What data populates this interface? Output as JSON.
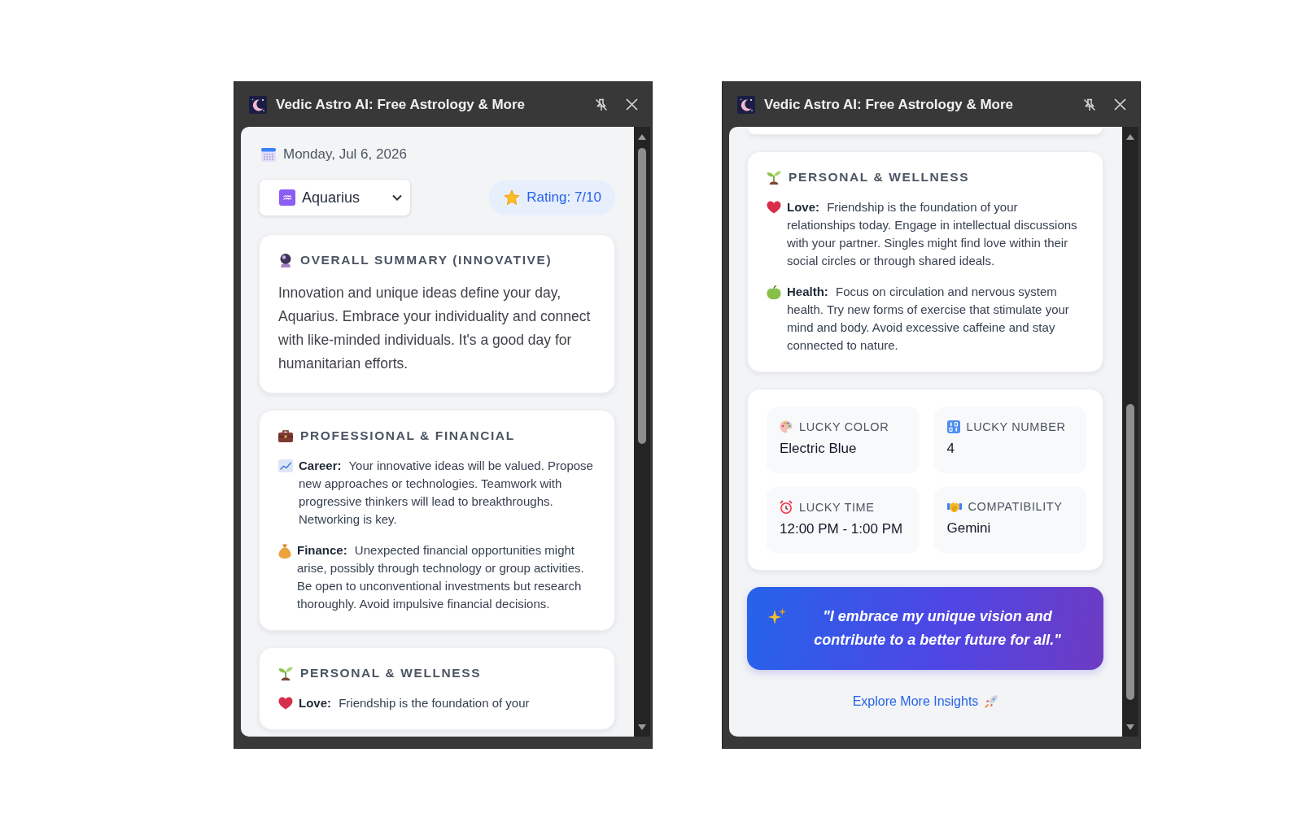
{
  "windows": [
    {
      "title": "Vedic Astro AI: Free Astrology & More",
      "scrolled": false,
      "content": [
        {
          "kind": "date",
          "text": "Monday, Jul 6, 2026"
        },
        {
          "kind": "controls",
          "sign": {
            "symbol": "♒",
            "label": "Aquarius"
          },
          "rating": "Rating: 7/10"
        },
        {
          "kind": "summary",
          "title": "OVERALL SUMMARY (INNOVATIVE)",
          "text": "Innovation and unique ideas define your day, Aquarius. Embrace your individuality and connect with like-minded individuals. It's a good day for humanitarian efforts."
        },
        {
          "kind": "professional",
          "title": "PROFESSIONAL & FINANCIAL",
          "items": [
            {
              "kind": "career",
              "label": "Career:",
              "text": "Your innovative ideas will be valued. Propose new approaches or technologies. Teamwork with progressive thinkers will lead to breakthroughs. Networking is key."
            },
            {
              "kind": "finance",
              "label": "Finance:",
              "text": "Unexpected financial opportunities might arise, possibly through technology or group activities. Be open to unconventional investments but research thoroughly. Avoid impulsive financial decisions."
            }
          ]
        },
        {
          "kind": "personal",
          "title": "PERSONAL & WELLNESS",
          "items": [
            {
              "kind": "love",
              "label": "Love:",
              "text": "Friendship is the foundation of your"
            }
          ]
        }
      ]
    },
    {
      "title": "Vedic Astro AI: Free Astrology & More",
      "scrolled": true,
      "content": [
        {
          "kind": "edge"
        },
        {
          "kind": "personal",
          "title": "PERSONAL & WELLNESS",
          "items": [
            {
              "kind": "love",
              "label": "Love:",
              "text": "Friendship is the foundation of your relationships today. Engage in intellectual discussions with your partner. Singles might find love within their social circles or through shared ideals."
            },
            {
              "kind": "health",
              "label": "Health:",
              "text": "Focus on circulation and nervous system health. Try new forms of exercise that stimulate your mind and body. Avoid excessive caffeine and stay connected to nature."
            }
          ]
        },
        {
          "kind": "lucky",
          "tiles": [
            {
              "kind": "color",
              "label": "LUCKY COLOR",
              "value": "Electric Blue"
            },
            {
              "kind": "number",
              "label": "LUCKY NUMBER",
              "value": "4"
            },
            {
              "kind": "time",
              "label": "LUCKY TIME",
              "value": "12:00 PM - 1:00 PM"
            },
            {
              "kind": "match",
              "label": "COMPATIBILITY",
              "value": "Gemini"
            }
          ]
        },
        {
          "kind": "quote",
          "text": "\"I embrace my unique vision and contribute to a better future for all.\""
        },
        {
          "kind": "link",
          "text": "Explore More Insights"
        }
      ]
    }
  ]
}
